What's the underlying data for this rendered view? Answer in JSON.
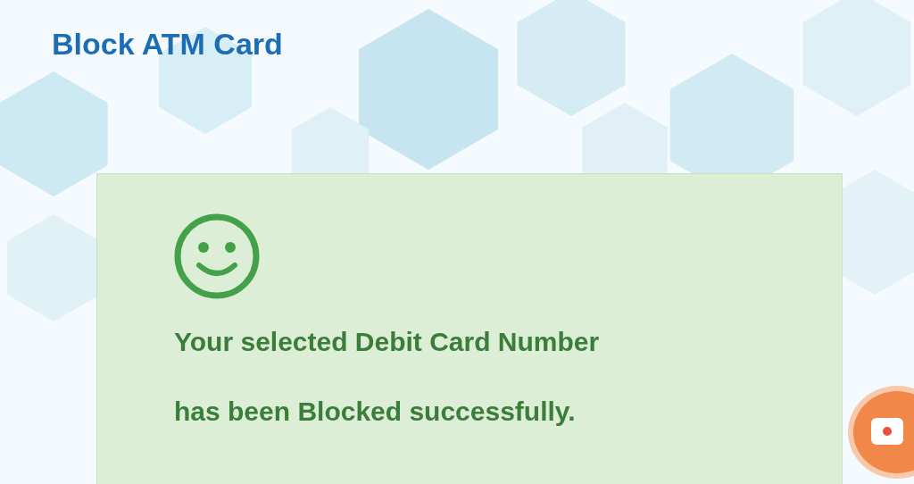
{
  "title": "Block ATM Card",
  "message": {
    "lines": [
      "Your selected Debit Card Number",
      "has been Blocked successfully."
    ]
  }
}
